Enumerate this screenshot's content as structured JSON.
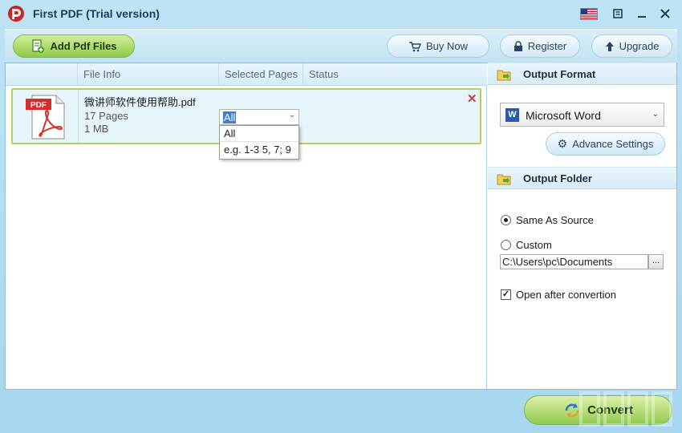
{
  "window": {
    "title": "First PDF (Trial version)",
    "controls": [
      "flag-icon",
      "menu-icon",
      "minimize-icon",
      "close-icon"
    ]
  },
  "toolbar": {
    "add_label": "Add Pdf Files",
    "buy_label": "Buy Now",
    "register_label": "Register",
    "upgrade_label": "Upgrade"
  },
  "file_list": {
    "columns": [
      "File Info",
      "Selected Pages",
      "Status"
    ],
    "rows": [
      {
        "name": "微讲师软件使用帮助.pdf",
        "pages": "17 Pages",
        "size": "1 MB",
        "selected_pages": "All",
        "icon_label": "PDF"
      }
    ],
    "page_options": [
      "All",
      "e.g. 1-3 5, 7; 9"
    ]
  },
  "output_format": {
    "header": "Output Format",
    "selected": "Microsoft Word",
    "advance_label": "Advance Settings"
  },
  "output_folder": {
    "header": "Output Folder",
    "same_as_source_label": "Same As Source",
    "custom_label": "Custom",
    "path": "C:\\Users\\pc\\Documents",
    "browse_label": "...",
    "open_after_label": "Open after convertion",
    "selected_option": "Same As Source",
    "open_after_checked": true
  },
  "actions": {
    "convert_label": "Convert"
  },
  "colors": {
    "accent_green": "#91c94e",
    "header_blue": "#d5ebf6",
    "border_blue": "#8fbfd9",
    "close_red": "#d23b3b"
  }
}
